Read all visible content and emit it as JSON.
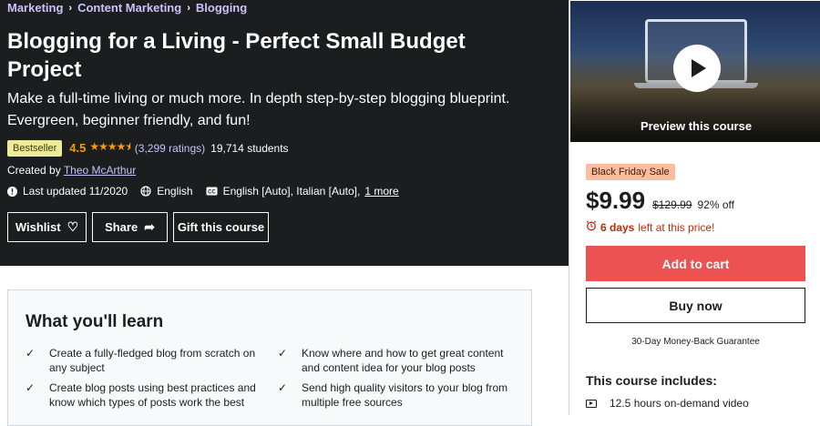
{
  "breadcrumb": [
    "Marketing",
    "Content Marketing",
    "Blogging"
  ],
  "course": {
    "title": "Blogging for a Living - Perfect Small Budget Project",
    "subtitle": "Make a full-time living or much more. In depth step-by-step blogging blueprint. Evergreen, beginner friendly, and fun!",
    "badge": "Bestseller",
    "rating": "4.5",
    "rating_count": "(3,299 ratings)",
    "students": "19,714 students",
    "created_by_label": "Created by",
    "instructor": "Theo McArthur",
    "last_updated": "Last updated 11/2020",
    "language": "English",
    "captions": "English [Auto], Italian [Auto],",
    "captions_more": "1 more"
  },
  "actions": {
    "wishlist": "Wishlist",
    "share": "Share",
    "gift": "Gift this course"
  },
  "learn": {
    "title": "What you'll learn",
    "items": [
      "Create a fully-fledged blog from scratch on any subject",
      "Know where and how to get great content and content idea for your blog posts",
      "Create blog posts using best practices and know which types of posts work the best",
      "Send high quality visitors to your blog from multiple free sources"
    ]
  },
  "sidebar": {
    "preview_label": "Preview this course",
    "sale_badge": "Black Friday Sale",
    "price": "$9.99",
    "original_price": "$129.99",
    "discount": "92% off",
    "countdown_days": "6 days",
    "countdown_rest": "left at this price!",
    "add_to_cart": "Add to cart",
    "buy_now": "Buy now",
    "guarantee": "30-Day Money-Back Guarantee",
    "includes_title": "This course includes:",
    "includes": [
      "12.5 hours on-demand video"
    ]
  },
  "colors": {
    "header_bg": "#1c1d1f",
    "breadcrumb_link": "#cec0fc",
    "star": "#f69c08",
    "bestseller_bg": "#eceb98",
    "sale_bg": "#fcbca0",
    "countdown_red": "#b32d0f",
    "cart_button": "#ec5252"
  }
}
